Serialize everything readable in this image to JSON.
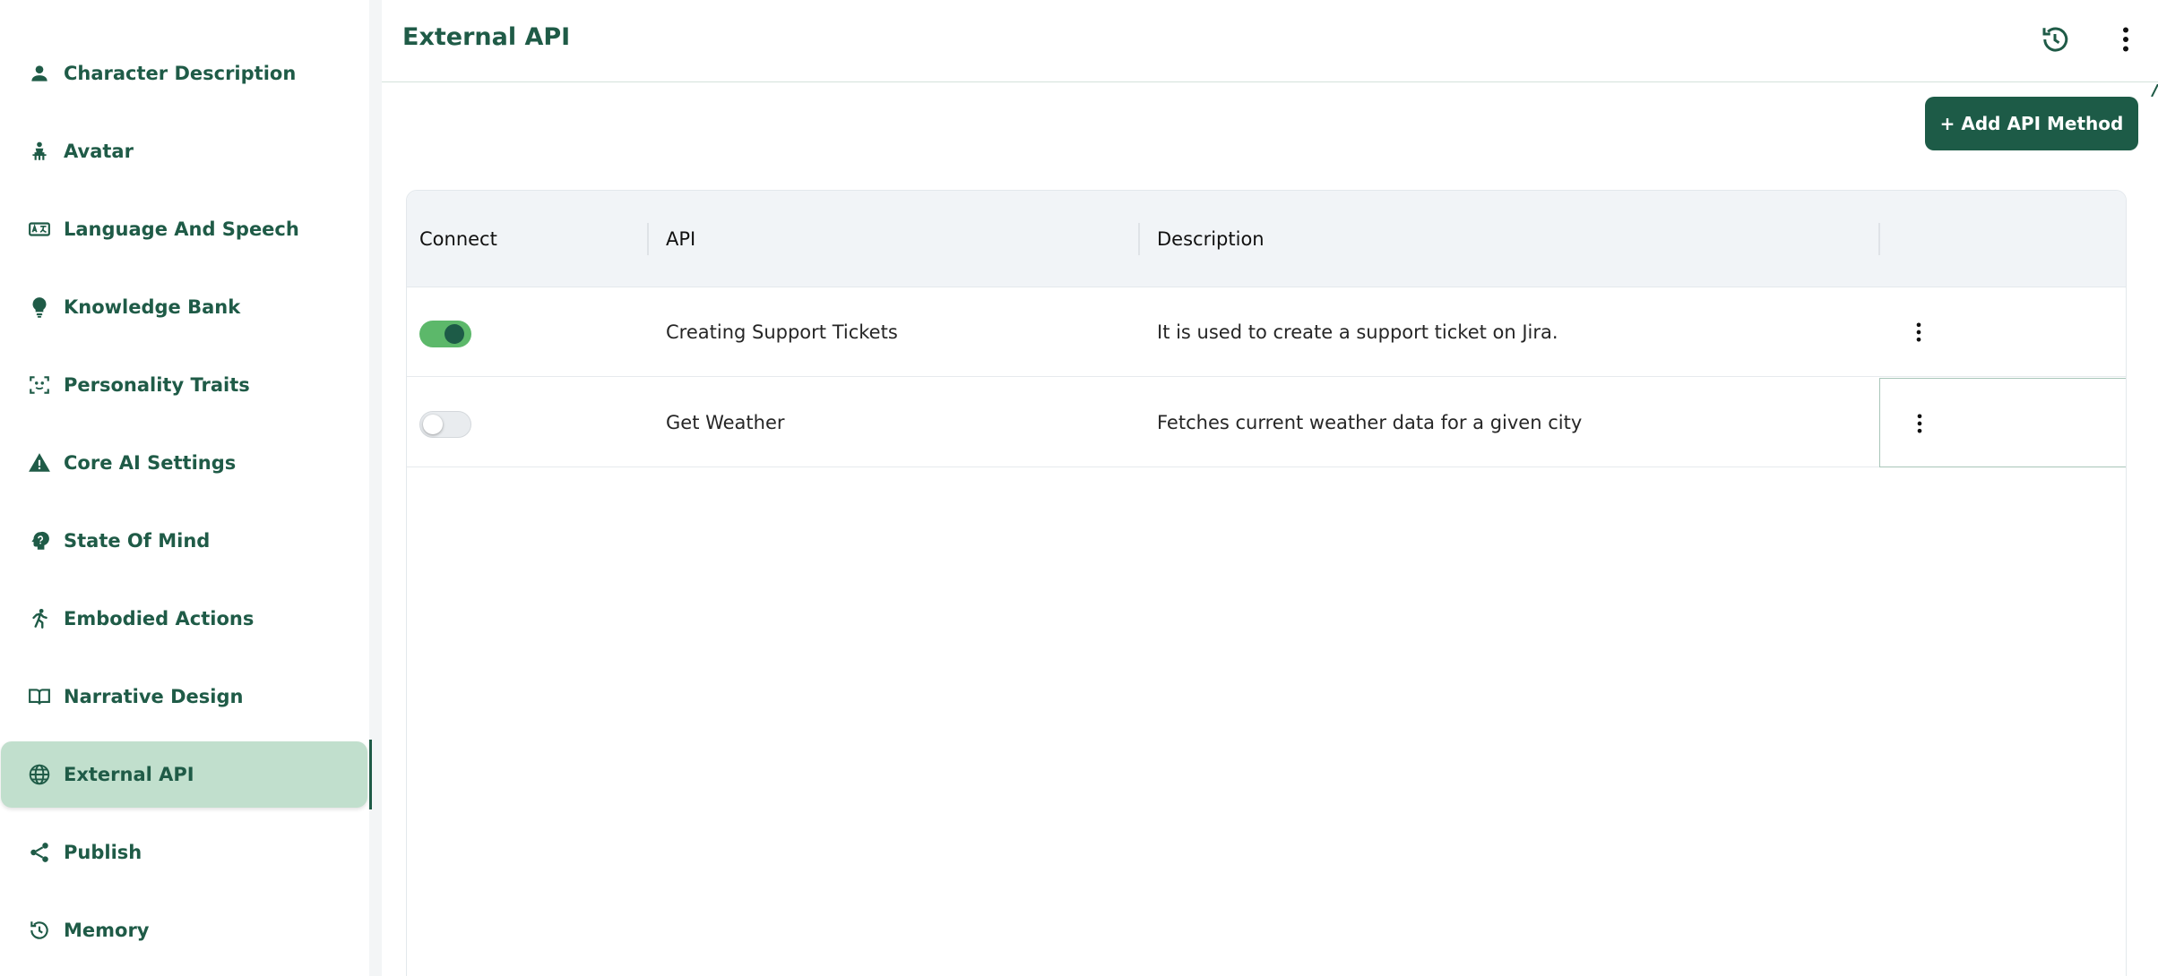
{
  "sidebar": {
    "items": [
      {
        "label": "Character Description",
        "icon": "person-icon"
      },
      {
        "label": "Avatar",
        "icon": "avatar-icon"
      },
      {
        "label": "Language And Speech",
        "icon": "translate-icon"
      },
      {
        "label": "Knowledge Bank",
        "icon": "lightbulb-icon"
      },
      {
        "label": "Personality Traits",
        "icon": "face-scan-icon"
      },
      {
        "label": "Core AI Settings",
        "icon": "warning-triangle-icon"
      },
      {
        "label": "State Of Mind",
        "icon": "head-icon"
      },
      {
        "label": "Embodied Actions",
        "icon": "running-person-icon"
      },
      {
        "label": "Narrative Design",
        "icon": "open-book-icon"
      },
      {
        "label": "External API",
        "icon": "globe-icon",
        "active": true
      },
      {
        "label": "Publish",
        "icon": "share-icon"
      },
      {
        "label": "Memory",
        "icon": "history-icon"
      }
    ]
  },
  "header": {
    "title": "External API",
    "icons": [
      "history-icon",
      "more-vertical-icon"
    ]
  },
  "toolbar": {
    "add_label": "+ Add API Method"
  },
  "table": {
    "columns": [
      "Connect",
      "API",
      "Description",
      ""
    ],
    "rows": [
      {
        "connected": true,
        "api": "Creating Support Tickets",
        "description": "It is used to create a support ticket on Jira."
      },
      {
        "connected": false,
        "api": "Get Weather",
        "description": "Fetches current weather data for a given city"
      }
    ]
  },
  "colors": {
    "brand": "#1d5b47",
    "active_bg": "#c1dfcd",
    "toggle_on": "#5cb86a",
    "header_bg": "#f1f4f7"
  }
}
